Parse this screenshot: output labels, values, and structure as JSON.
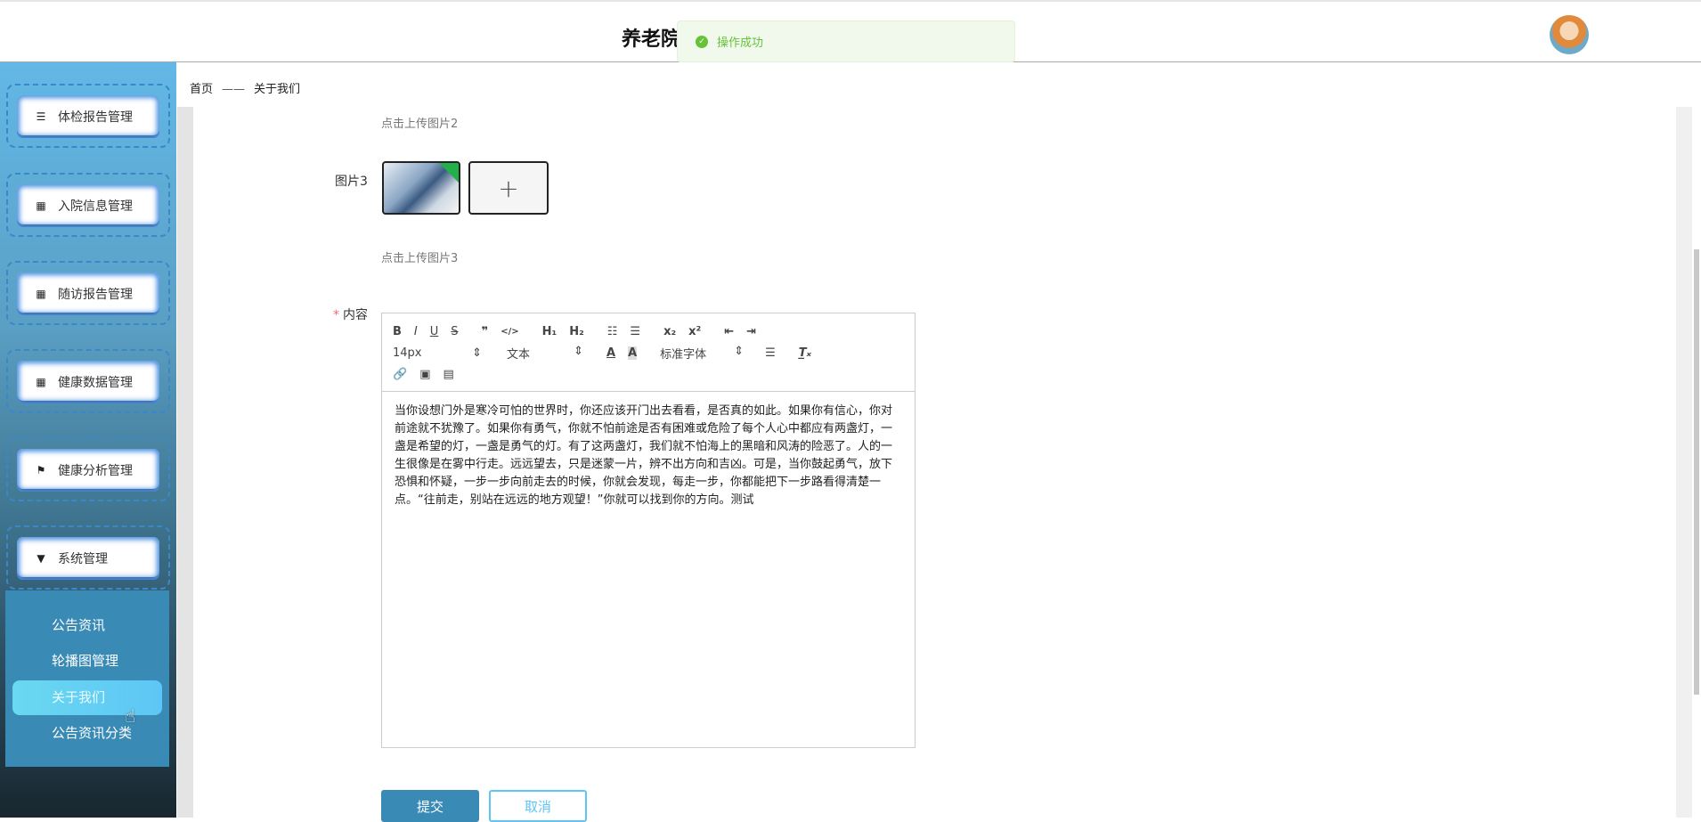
{
  "header": {
    "title": "养老院",
    "toast": "操作成功",
    "toast_color": "#67c23a"
  },
  "sidebar": {
    "items": [
      {
        "label": "体检报告管理",
        "icon": "list-icon"
      },
      {
        "label": "入院信息管理",
        "icon": "grid-icon"
      },
      {
        "label": "随访报告管理",
        "icon": "grid-icon"
      },
      {
        "label": "健康数据管理",
        "icon": "grid-icon"
      },
      {
        "label": "健康分析管理",
        "icon": "flag-icon"
      },
      {
        "label": "系统管理",
        "icon": "brush-icon"
      }
    ],
    "submenu": [
      {
        "label": "公告资讯"
      },
      {
        "label": "轮播图管理"
      },
      {
        "label": "关于我们",
        "active": true
      },
      {
        "label": "公告资讯分类"
      }
    ]
  },
  "breadcrumb": {
    "home": "首页",
    "sep": "——",
    "current": "关于我们"
  },
  "form": {
    "hint2": "点击上传图片2",
    "image3_label": "图片3",
    "plus": "+",
    "hint3": "点击上传图片3",
    "content_label": "内容",
    "required": "*",
    "toolbar": {
      "font_size": "14px",
      "header": "文本",
      "font": "标准字体"
    },
    "content": "当你设想门外是寒冷可怕的世界时，你还应该开门出去看看，是否真的如此。如果你有信心，你对前途就不犹豫了。如果你有勇气，你就不怕前途是否有困难或危险了每个人心中都应有两盏灯，一盏是希望的灯，一盏是勇气的灯。有了这两盏灯，我们就不怕海上的黑暗和风涛的险恶了。人的一生很像是在雾中行走。远远望去，只是迷蒙一片，辨不出方向和吉凶。可是，当你鼓起勇气，放下恐惧和怀疑，一步一步向前走去的时候，你就会发现，每走一步，你都能把下一步路看得清楚一点。“往前走，别站在远远的地方观望！”你就可以找到你的方向。测试",
    "submit": "提交",
    "cancel": "取消"
  }
}
